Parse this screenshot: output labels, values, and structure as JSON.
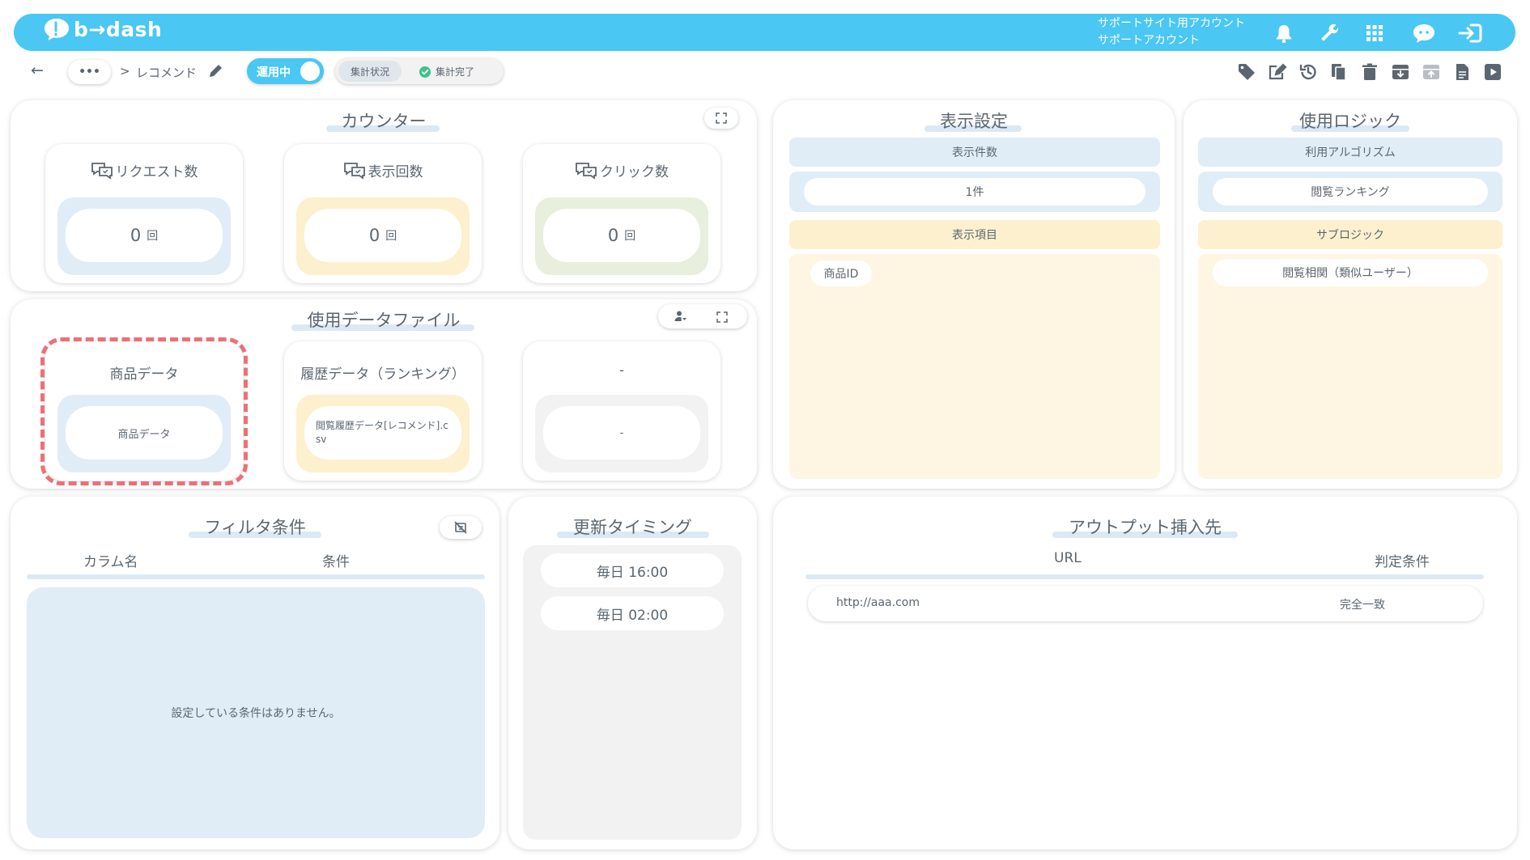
{
  "app": {
    "logo_text": "b→dash",
    "account_line1": "サポートサイト用アカウント",
    "account_line2": "サポートアカウント"
  },
  "topbar_icons": [
    "bell-icon",
    "wrench-icon",
    "grid-icon",
    "chat-bot-icon",
    "logout-icon"
  ],
  "nav": {
    "back": "←",
    "more": "•••",
    "separator": ">",
    "page_name": "レコメンド",
    "status_toggle": "運用中",
    "agg_status_label": "集計状況",
    "agg_status_value": "集計完了"
  },
  "toolbar_icons": [
    "tag-icon",
    "edit-note-icon",
    "history-icon",
    "copy-icon",
    "trash-icon",
    "archive-down-icon",
    "archive-up-icon",
    "document-icon",
    "play-icon"
  ],
  "counter": {
    "title": "カウンター",
    "items": [
      {
        "label": "リクエスト数",
        "value": "0",
        "unit": "回"
      },
      {
        "label": "表示回数",
        "value": "0",
        "unit": "回"
      },
      {
        "label": "クリック数",
        "value": "0",
        "unit": "回"
      }
    ]
  },
  "datafiles": {
    "title": "使用データファイル",
    "items": [
      {
        "label": "商品データ",
        "value": "商品データ"
      },
      {
        "label": "履歴データ（ランキング）",
        "value": "閲覧履歴データ[レコメンド].csv"
      },
      {
        "label": "-",
        "value": "-"
      }
    ]
  },
  "display": {
    "title": "表示設定",
    "count_header": "表示件数",
    "count_value": "1件",
    "items_header": "表示項目",
    "items": [
      "商品ID"
    ]
  },
  "logic": {
    "title": "使用ロジック",
    "algo_header": "利用アルゴリズム",
    "algo_value": "閲覧ランキング",
    "sub_header": "サブロジック",
    "sub_value": "閲覧相関（類似ユーザー）"
  },
  "filter": {
    "title": "フィルタ条件",
    "col_header": "カラム名",
    "cond_header": "条件",
    "empty_message": "設定している条件はありません。"
  },
  "timing": {
    "title": "更新タイミング",
    "items": [
      "毎日 16:00",
      "毎日 02:00"
    ]
  },
  "output": {
    "title": "アウトプット挿入先",
    "url_header": "URL",
    "cond_header": "判定条件",
    "rows": [
      {
        "url": "http://aaa.com",
        "cond": "完全一致"
      }
    ]
  },
  "colors": {
    "brand": "#4ac7f3",
    "blue_tint": "#e0edf7",
    "yellow_tint": "#fdf0cf",
    "green_tint": "#e8efdc",
    "gray_tint": "#f2f2f2",
    "highlight": "#ee6f76"
  }
}
